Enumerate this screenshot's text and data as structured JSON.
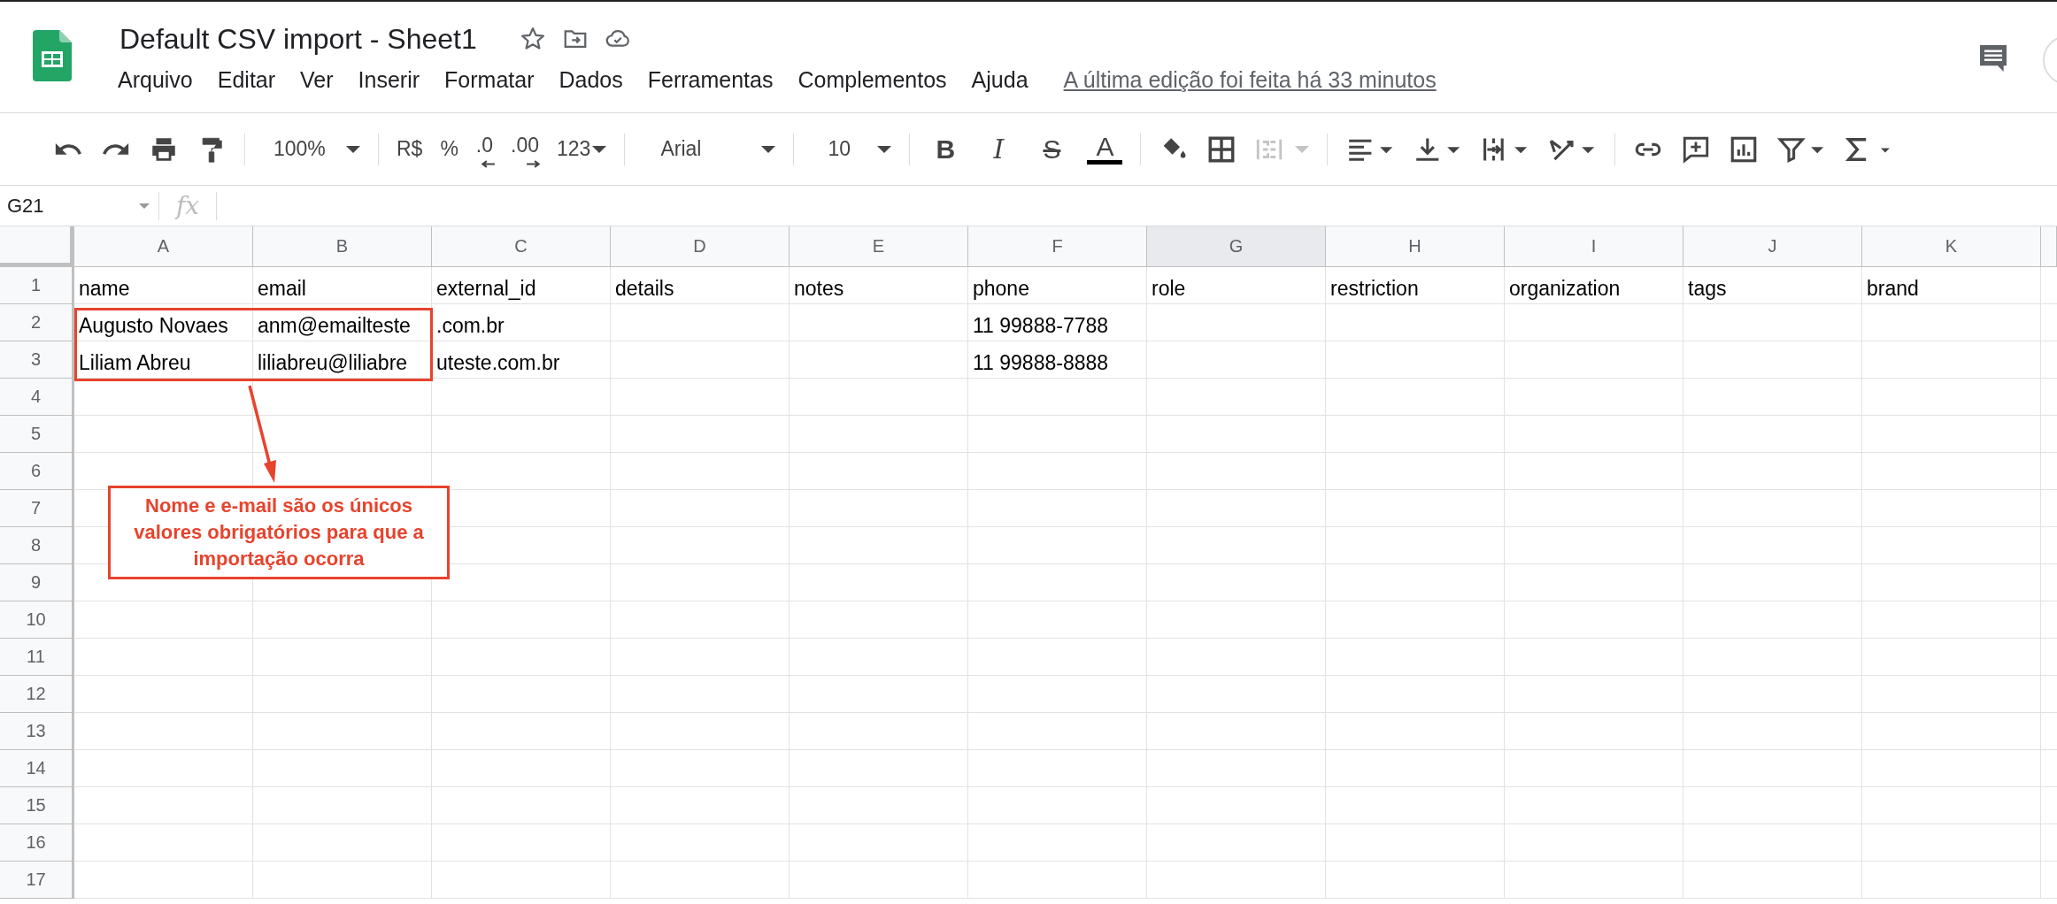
{
  "document": {
    "title": "Default CSV import - Sheet1"
  },
  "menu": [
    "Arquivo",
    "Editar",
    "Ver",
    "Inserir",
    "Formatar",
    "Dados",
    "Ferramentas",
    "Complementos",
    "Ajuda"
  ],
  "last_edit": "A última edição foi feita há 33 minutos",
  "toolbar": {
    "zoom": "100%",
    "currency": "R$",
    "percent": "%",
    "decrease_decimals": ".0",
    "increase_decimals": ".00",
    "number_format": "123",
    "font": "Arial",
    "font_size": "10",
    "bold": "B",
    "italic": "I",
    "strikethrough": "S",
    "text_color": "A",
    "merge_disabled": true
  },
  "formula_bar": {
    "cell_ref": "G21",
    "fx": "fx"
  },
  "sheet": {
    "columns": [
      {
        "label": "A",
        "selected": false
      },
      {
        "label": "B",
        "selected": false
      },
      {
        "label": "C",
        "selected": false
      },
      {
        "label": "D",
        "selected": false
      },
      {
        "label": "E",
        "selected": false
      },
      {
        "label": "F",
        "selected": false
      },
      {
        "label": "G",
        "selected": true
      },
      {
        "label": "H",
        "selected": false
      },
      {
        "label": "I",
        "selected": false
      },
      {
        "label": "J",
        "selected": false
      },
      {
        "label": "K",
        "selected": false
      }
    ],
    "rows": [
      {
        "number": "1",
        "cells": {
          "A": "name",
          "B": "email",
          "C": "external_id",
          "D": "details",
          "E": "notes",
          "F": "phone",
          "G": "role",
          "H": "restriction",
          "I": "organization",
          "J": "tags",
          "K": "brand"
        }
      },
      {
        "number": "2",
        "cells": {
          "A": "Augusto Novaes",
          "B": "anm@emailteste",
          "C": ".com.br",
          "F": "11 99888-7788"
        }
      },
      {
        "number": "3",
        "cells": {
          "A": "Liliam Abreu",
          "B": "liliabreu@liliabre",
          "C": "uteste.com.br",
          "F": "11 99888-8888"
        }
      },
      {
        "number": "4"
      },
      {
        "number": "5"
      },
      {
        "number": "6"
      },
      {
        "number": "7"
      },
      {
        "number": "8"
      },
      {
        "number": "9"
      },
      {
        "number": "10"
      },
      {
        "number": "11"
      },
      {
        "number": "12"
      },
      {
        "number": "13"
      },
      {
        "number": "14"
      },
      {
        "number": "15"
      },
      {
        "number": "16"
      },
      {
        "number": "17"
      }
    ]
  },
  "annotation": {
    "text": "Nome e e-mail são os únicos valores obrigatórios para que a importação ocorra"
  }
}
